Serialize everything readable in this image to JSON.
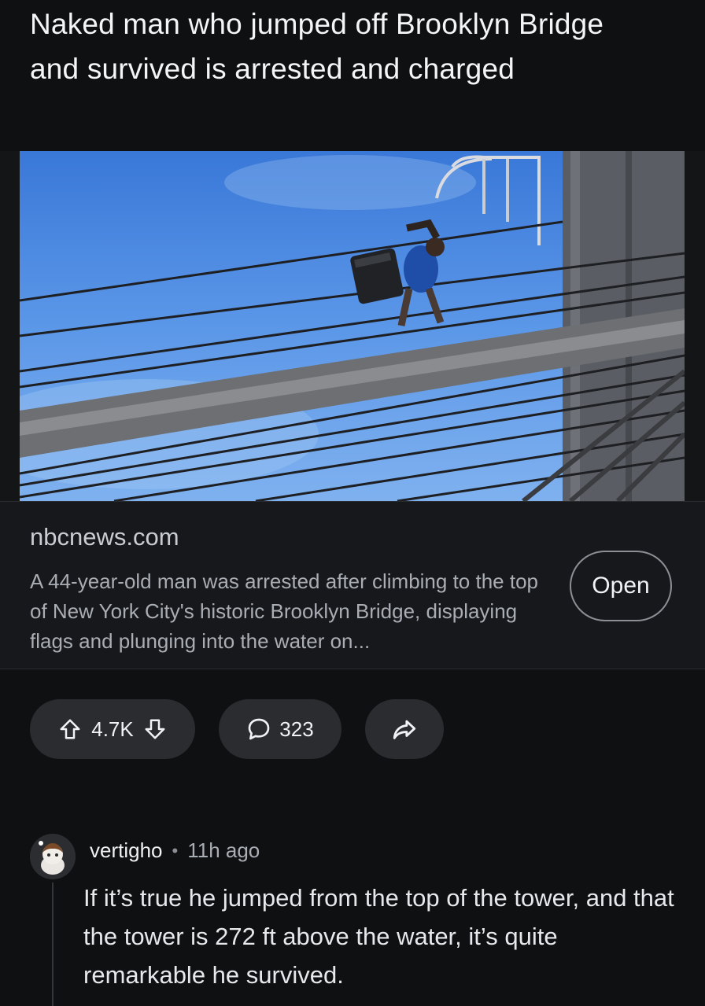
{
  "post": {
    "title": "Naked man who jumped off Brooklyn Bridge and survived is arrested and charged"
  },
  "link_card": {
    "domain": "nbcnews.com",
    "description": "A 44-year-old man was arrested after climbing to the top of New York City's historic Brooklyn Bridge, displaying flags and plunging into the water on...",
    "open_label": "Open"
  },
  "actions": {
    "votes": "4.7K",
    "comments": "323"
  },
  "icons": [
    "upvote-icon",
    "downvote-icon",
    "comment-icon",
    "share-icon"
  ],
  "comment": {
    "author": "vertigho",
    "separator": "•",
    "time": "11h ago",
    "body": "If it’s true he jumped from the top of the tower, and that the tower is 272 ft above the water, it’s quite remarkable he survived."
  }
}
